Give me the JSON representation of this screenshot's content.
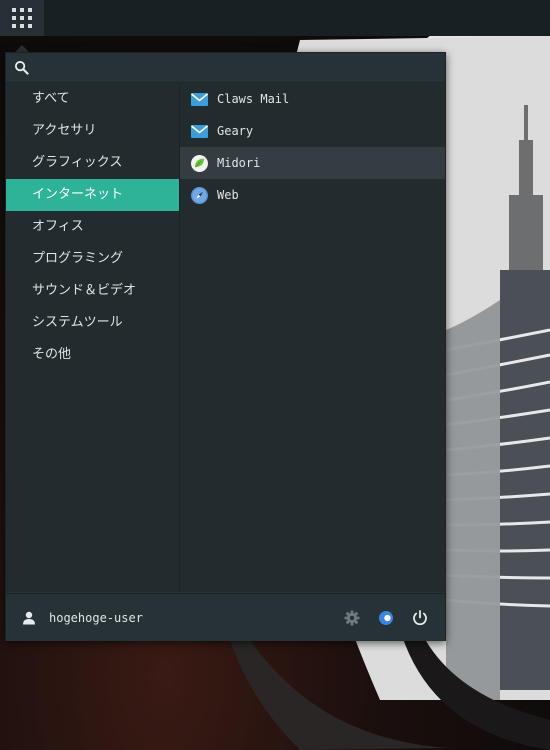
{
  "search": {
    "placeholder": "",
    "value": ""
  },
  "categories": [
    {
      "label": "すべて"
    },
    {
      "label": "アクセサリ"
    },
    {
      "label": "グラフィックス"
    },
    {
      "label": "インターネット",
      "active": true
    },
    {
      "label": "オフィス"
    },
    {
      "label": "プログラミング"
    },
    {
      "label": "サウンド＆ビデオ"
    },
    {
      "label": "システムツール"
    },
    {
      "label": "その他"
    }
  ],
  "apps": [
    {
      "label": "Claws Mail",
      "icon": "mail-icon"
    },
    {
      "label": "Geary",
      "icon": "mail-icon"
    },
    {
      "label": "Midori",
      "icon": "leaf-icon",
      "hover": true
    },
    {
      "label": "Web",
      "icon": "compass-icon"
    }
  ],
  "footer": {
    "user_name": "hogehoge-user",
    "buttons": [
      "settings-icon",
      "lock-icon",
      "power-icon"
    ]
  },
  "colors": {
    "accent": "#2eb398",
    "menu_bg": "#263236",
    "list_bg": "#222b2e",
    "panel_bg": "#192023"
  }
}
